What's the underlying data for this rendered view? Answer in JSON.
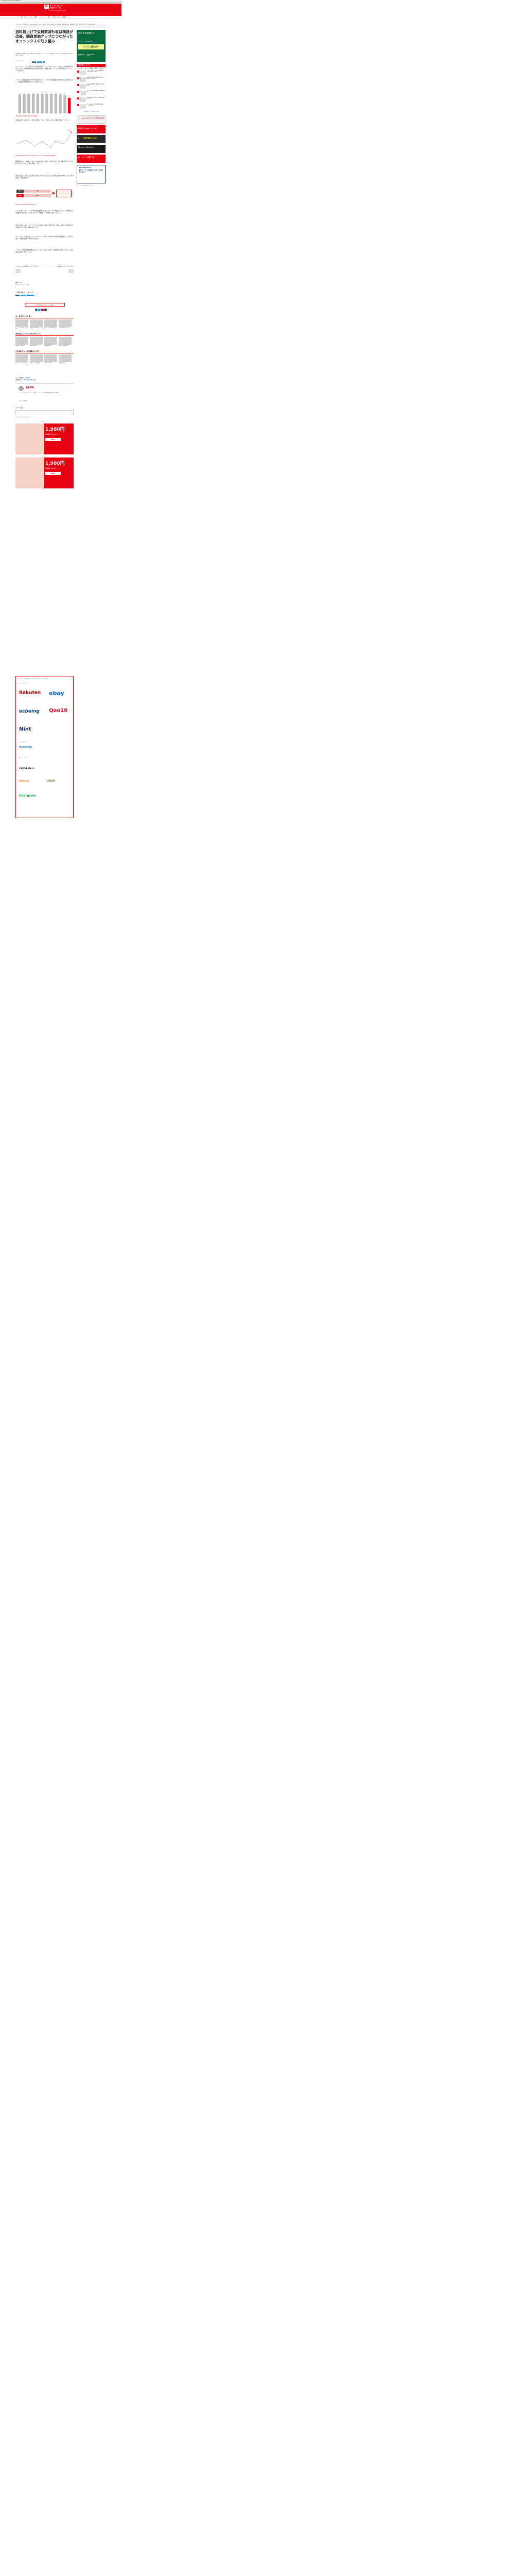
{
  "browser": {
    "url": "netshop.impress.co.jp/node/8099"
  },
  "header": {
    "logo_mark": "ネ",
    "logo_line1": "ネットショップ",
    "logo_line2": "担当者フォーラム",
    "logo_en": "NETSHOP TANTOSHA FORUM",
    "nav": [
      "ニュース",
      "事例",
      "セミナー",
      "ECで",
      "用語集",
      "ソリューション",
      "資料",
      "EC技術ビジネス",
      "経営戦略",
      "Q"
    ]
  },
  "breadcrumb": "ネットショップ担当者フォーラム > 株式会社 > スクール事例 > 食品 > 送料値上げで会員数減も収益構造が改善、購買単価アップにつながったオイシックスの取り組み",
  "article": {
    "title": "送料値上げで会員数減も収益構造が改善、購買単価アップにつながったオイシックスの取り組み",
    "lead": "会員数の減少を改善するため、送料の値上げを実施したオイシックス。会員数は減ったものの、収益構造は改善。値上げの狙いと効果は?",
    "date": "2019/5/13 9:00",
    "share": [
      "いいね",
      "ツイート",
      "B!",
      "ブックマーク"
    ],
    "p1": "オイシックス・ラ・大地が手がける食品宅配サービス「Oisix（オイシックス）」の収益構造が改善している。2019年3月期第4四半期は増収で、会員数が減少した一方、購買単価がアップしたことが寄与した。",
    "p2": "「Oisix」の会員数は2019年3月末時点で20万人。2019年は会員数の減少を受けて送料を値上げし、会員数が前年同期比で17.5%減の17万人へ。",
    "chart1_caption": "会員数の推移（会員数は今期末時点の会員数）",
    "p3": "会員数の減少とは反対に、ARPUは増加しており、会員1人あたりの購買単価はアップした。",
    "chart2_caption": "ARPUは前年同月比で上昇（左軸：会員1人あたり売上高、右軸：前年同月比増加率）",
    "p4": "購買単価の向上に貢献したのは、2018年11月に実施した送料の改定。従来は購入額に応じて送料を変えていたが、会員の送料を一律化した。",
    "p5": "送料の改定は、会員にとって購入価格の上昇につながるが、1回当たりの注文単価を上げるための施策として位置づけた。",
    "chart3_caption": "送料の改定（会員が負担する送料を見直した）",
    "p6": "こうした施策により、11月以降は会員数が減少したものの、購入単価が上昇した。注文単価の上昇は配送の効率化にもつながっており、物流コストの削減にも寄与している。",
    "p7": "送料の見直しに加え、オイシックスでは会員の年間購入回数を増やす施策も展開。定期宅配の利用者数を増やす取り組みを進めている。",
    "p8": "オイシックス（旧会社名：オイシックスドット大地）の2019年3月期の連結業績は、売上高640億円、営業利益が前年同期比で増加した。",
    "p9": "「Oisix」の会員数は会員数は減少しているが、会員1人あたりの購買単価は上昇しており、収益構造は改善に向かっている。",
    "prev_link": "今日のおすすめ記事タイトルがここに入ります",
    "next_link": "次の記事タイトルがここに入ります",
    "related_label": "関連リンク:",
    "related_item": "オイシックス・ラ・大地",
    "share_label": "この記事が役に立ったらシェア!",
    "cta": "「ECで稼ぐためのヒント」を読む",
    "you_may": "今、あなたにオススメ",
    "web_section": "Web担コンテンツからのオススメ",
    "other_section": "その他のサイトの記事もいかが?",
    "news_label": "ニュース分野:",
    "news_value": "EC・通販全般",
    "category_label": "記事カテゴリー:",
    "category_value": "食品・飲料, 通販, 物流",
    "author_name": "渡部 和章",
    "author_role": "ライター",
    "author_bio": "フリーランスのライター。EC・物流・マーケティング分野の取材記事を中心に執筆。",
    "author_link": "ライアブの記事",
    "comment_label": "コメントを書く"
  },
  "chart1": {
    "type": "bar",
    "categories": [
      "FY2017 Q1",
      "FY2017 Q2",
      "FY2017 Q3",
      "FY2017 Q4",
      "FY2018 Q1",
      "FY2018 Q2",
      "FY2018 Q3",
      "FY2018 Q4",
      "FY2019 Q1",
      "FY2019 Q2",
      "FY2019 Q3",
      "FY2019 Q4"
    ],
    "values": [
      210,
      212,
      213,
      214,
      215,
      216,
      217,
      217,
      215,
      210,
      205,
      170
    ],
    "ylim": [
      0,
      240
    ],
    "title": "",
    "xlabel": "",
    "ylabel": "",
    "highlight_color": "#e60012"
  },
  "chart2": {
    "type": "line",
    "categories": [
      "1",
      "2",
      "3",
      "4",
      "5",
      "6",
      "7",
      "8",
      "9",
      "10",
      "11",
      "12",
      "13",
      "14"
    ],
    "values": [
      6200,
      6400,
      6600,
      6300,
      5800,
      6100,
      6400,
      6000,
      5600,
      6500,
      6300,
      6100,
      6700,
      7800
    ],
    "ylim": [
      5000,
      8000
    ],
    "title": "",
    "xlabel": "",
    "ylabel": ""
  },
  "chart3": {
    "type": "table",
    "rows": [
      "変更前",
      "変更後"
    ],
    "values": [
      "無料",
      "800円〜"
    ]
  },
  "sidebar": {
    "promo_title": "BtoB ECの決済なら!",
    "promo_sub": "ヤマトグループの掛売決済代行",
    "promo_brand": "クロネコ掛け払い",
    "promo_text": "初期費用0円　与信通過率100%",
    "ranking_title": "人気記事ランキング",
    "ranking_tabs": [
      "1日",
      "1週間",
      "1か月"
    ],
    "ranking": [
      "アマゾンのAmazon Payを比較分析してわかった新しい潮流",
      "楽天市場の物流サービスが本格化、送料無料ラインを統一",
      "ZOZOの会員数データで見えた成長の鍵とは",
      "メルカリの越境EC戦略と海外展開の現状",
      "EC担当者が知っておくべき最新の決済トレンド",
      "ネットショップの売上を伸ばす商品ページの作り方"
    ],
    "rank_more": "人気記事ランキングをもっと見る",
    "ad_banners": [
      "ネットショップのノウハウがよくわかる本がタダ",
      "物流だけじゃない レオレオ",
      "スイーツ通販 集客を大成功!",
      "売れるショップのつくり方 ",
      "ネットショップ 運営をサポート",
      "競合メーカーの商品はどうやって売れているか?"
    ],
    "nint_brand": "Nint Research",
    "seo_text": "ネットショップ担当者フォーラム",
    "news_ticker": "人気のバナー広告"
  },
  "thumbs_row1": [
    "オイシックスの新サービスを紹介",
    "EC事業の成長戦略について",
    "物流コスト削減の取り組み",
    "会員数増加の施策まとめ"
  ],
  "thumbs_row2": [
    "Webマーケ最新動向",
    "SNS活用のコツ",
    "広告運用の基本",
    "SEO対策の最新情報"
  ],
  "thumbs_row3": [
    "ECサイトの売上を伸ばす方法",
    "通販ビジネスの最前線",
    "小売業のDX事例",
    "消費者調査レポート"
  ],
  "ad_bottom": {
    "brand": "Oisix",
    "price": "1,980円",
    "tagline": "送料無料 お試しセット",
    "badge": "お試し"
  },
  "footer": {
    "intro": "ネットショップ担当者フォーラムを支えるスポンサーのご紹介",
    "gold_label": "ゴールドスポンサー",
    "silver_label": "シルバースポンサー",
    "bronze_label": "ブロンズスポンサー",
    "sponsors_gold": [
      "Rakuten",
      "ebay",
      "ecbeing",
      "Qoo10",
      "Nint"
    ],
    "sponsors_silver": [
      "futureshop"
    ],
    "sponsors_bronze": [
      "CROSS MALL",
      "Wowma!",
      "CREAM",
      "Usergram"
    ]
  }
}
